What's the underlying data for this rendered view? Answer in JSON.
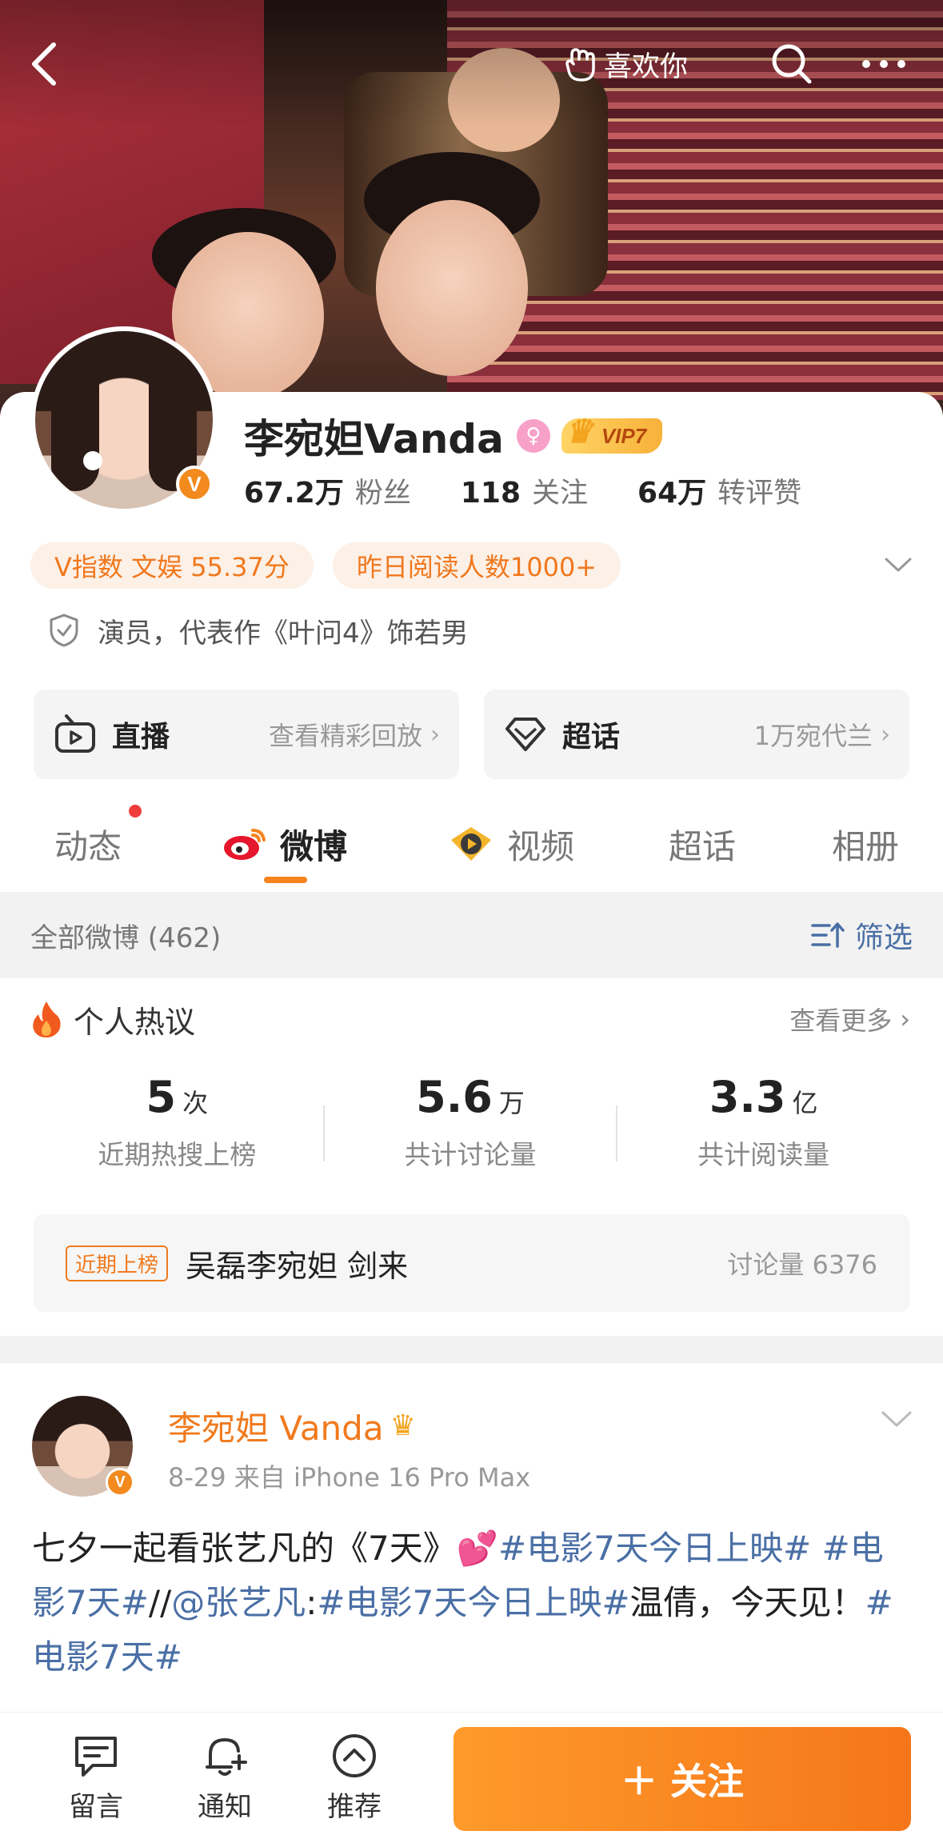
{
  "header": {
    "like_label": "喜欢你"
  },
  "profile": {
    "name": "李宛妲Vanda",
    "vip_label": "VIP7",
    "verified_badge": "V",
    "stats": [
      {
        "num": "67.2万",
        "label": "粉丝"
      },
      {
        "num": "118",
        "label": "关注"
      },
      {
        "num": "64万",
        "label": "转评赞"
      }
    ],
    "tags": [
      "V指数 文娱 55.37分",
      "昨日阅读人数1000+"
    ],
    "bio": "演员，代表作《叶问4》饰若男"
  },
  "features": [
    {
      "title": "直播",
      "subtitle": "查看精彩回放"
    },
    {
      "title": "超话",
      "subtitle": "1万宛代兰"
    }
  ],
  "tabs": [
    "动态",
    "微博",
    "视频",
    "超话",
    "相册"
  ],
  "filter": {
    "all_label": "全部微博 (462)",
    "filter_label": "筛选"
  },
  "hot": {
    "title": "个人热议",
    "more": "查看更多",
    "stats": [
      {
        "num": "5",
        "unit": "次",
        "caption": "近期热搜上榜"
      },
      {
        "num": "5.6",
        "unit": "万",
        "caption": "共计讨论量"
      },
      {
        "num": "3.3",
        "unit": "亿",
        "caption": "共计阅读量"
      }
    ],
    "trend_badge": "近期上榜",
    "trend_topic": "吴磊李宛妲 剑来",
    "trend_disc": "讨论量 6376"
  },
  "post": {
    "author": "李宛妲 Vanda",
    "meta": "8-29  来自 iPhone 16 Pro Max",
    "text_parts": [
      {
        "t": "七夕一起看张艺凡的《7天》💕",
        "link": false
      },
      {
        "t": "#电影7天今日上映#",
        "link": true
      },
      {
        "t": " ",
        "link": false
      },
      {
        "t": "#电影7天#",
        "link": true
      },
      {
        "t": "//",
        "link": false
      },
      {
        "t": "@张艺凡",
        "link": true
      },
      {
        "t": ":",
        "link": false
      },
      {
        "t": "#电影7天今日上映#",
        "link": true
      },
      {
        "t": "温倩，今天见！",
        "link": false
      },
      {
        "t": "#电影7天#",
        "link": true
      }
    ]
  },
  "bottom": {
    "items": [
      "留言",
      "通知",
      "推荐"
    ],
    "follow": "＋ 关注"
  },
  "colors": {
    "accent": "#f7831e",
    "link": "#4a6fa5",
    "tag_bg": "#fdf0e6"
  }
}
